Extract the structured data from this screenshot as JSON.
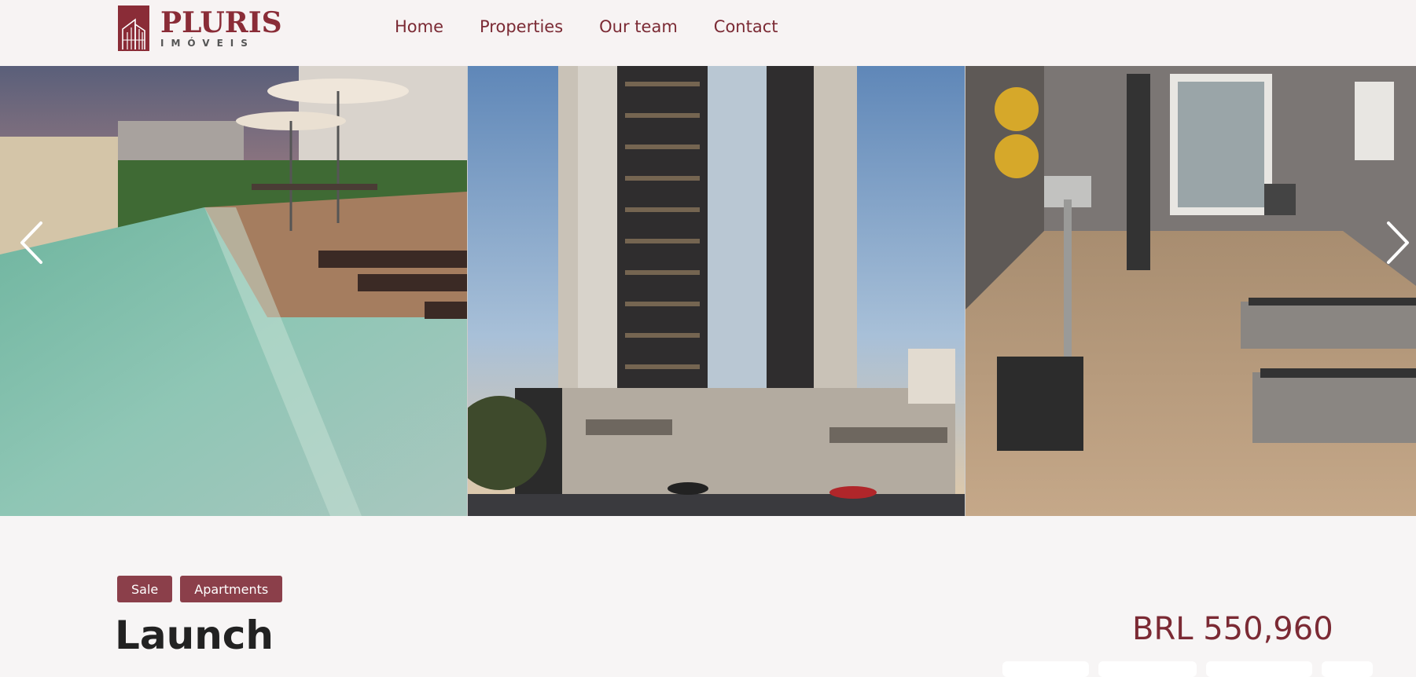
{
  "brand": {
    "name": "PLURIS",
    "subtitle": "IMÓVEIS",
    "color": "#8a2c37"
  },
  "nav": {
    "items": [
      {
        "label": "Home"
      },
      {
        "label": "Properties"
      },
      {
        "label": "Our team"
      },
      {
        "label": "Contact"
      }
    ]
  },
  "gallery": {
    "slides": [
      {
        "subject": "pool-area"
      },
      {
        "subject": "residential-tower"
      },
      {
        "subject": "gym"
      }
    ],
    "prev_icon": "chevron-left-icon",
    "next_icon": "chevron-right-icon"
  },
  "listing": {
    "tags": [
      "Sale",
      "Apartments"
    ],
    "title": "Launch",
    "price": "BRL 550,960"
  },
  "colors": {
    "accent": "#8b3f4a",
    "nav_text": "#7b2a34",
    "background": "#f7f5f5"
  }
}
